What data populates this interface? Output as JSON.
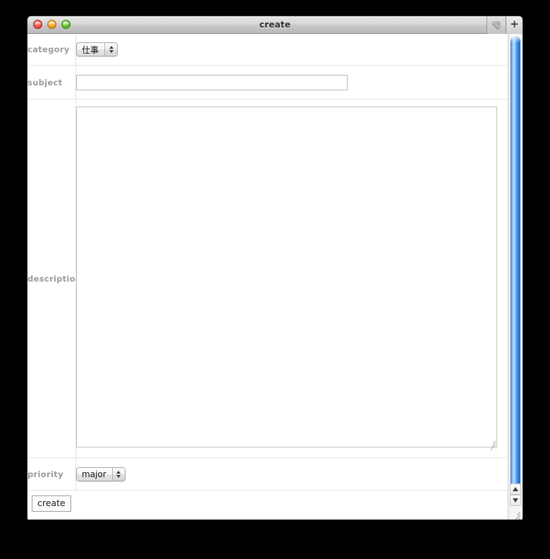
{
  "window": {
    "title": "create",
    "controls": {
      "close": "close-button",
      "minimize": "minimize-button",
      "maximize": "maximize-button"
    },
    "titlebar_right": {
      "toolbar_toggle_icon": "diagonal-lines-icon",
      "add_tab_label": "+"
    }
  },
  "form": {
    "rows": [
      {
        "label": "category",
        "type": "select",
        "value": "仕事"
      },
      {
        "label": "subject",
        "type": "text",
        "value": "",
        "placeholder": ""
      },
      {
        "label": "description",
        "type": "textarea",
        "value": "",
        "placeholder": ""
      },
      {
        "label": "priority",
        "type": "select",
        "value": "major"
      }
    ]
  },
  "footer": {
    "submit_label": "create"
  },
  "scrollbar": {
    "up_arrow_icon": "triangle-up-icon",
    "down_arrow_icon": "triangle-down-icon",
    "thumb_color": "#3f8fe0"
  },
  "colors": {
    "label_text": "#9b9b9b",
    "window_border": "#2b2b2b",
    "divider": "#e4e4e4",
    "input_border": "#b7b7b7",
    "scroll_accent": "#3f8fe0",
    "background": "#000000"
  }
}
